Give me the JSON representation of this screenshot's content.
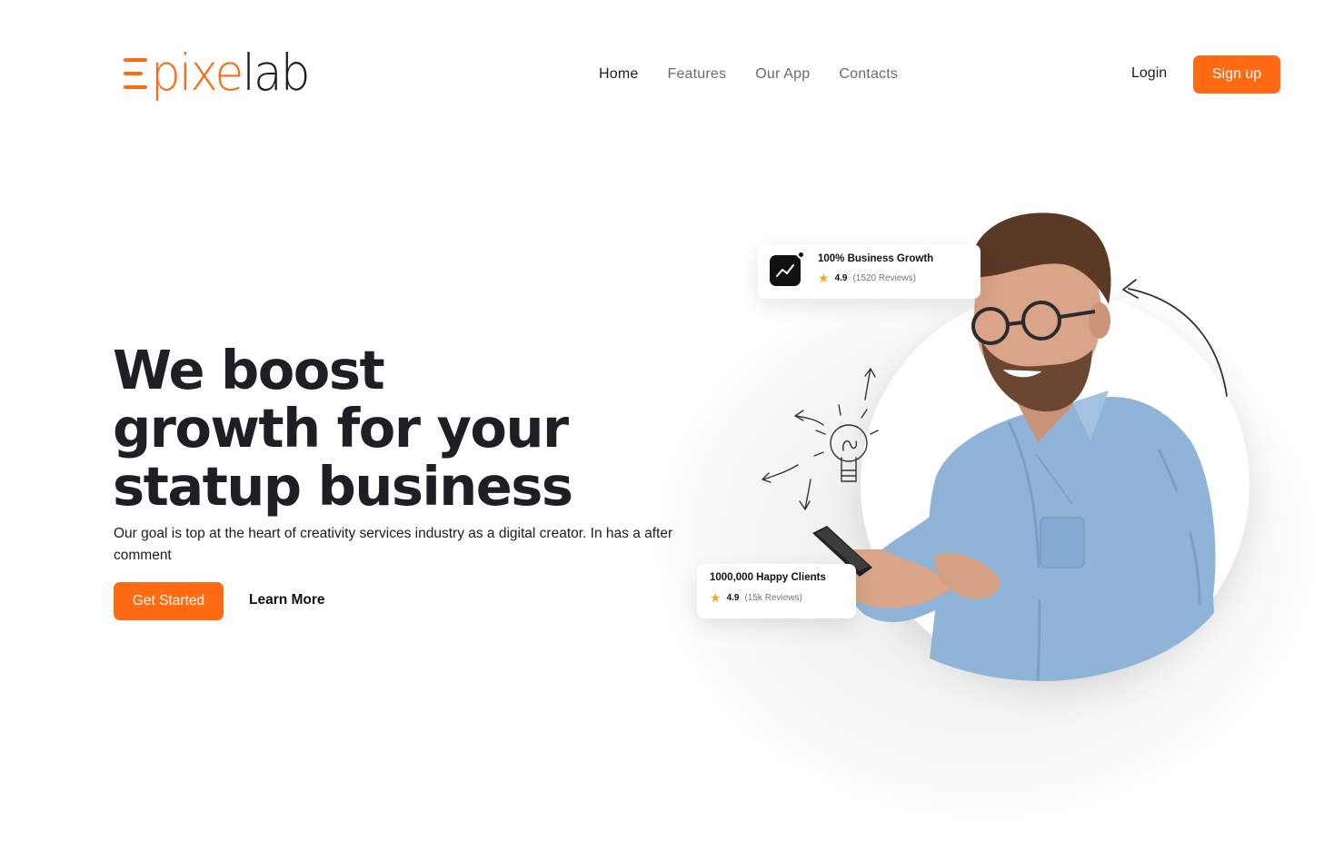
{
  "brand": {
    "logo_mark": "E",
    "logo_part1": "pixe",
    "logo_part2": "lab",
    "accent_color": "#ff6a13"
  },
  "nav": {
    "items": [
      {
        "label": "Home",
        "active": true
      },
      {
        "label": "Features",
        "active": false
      },
      {
        "label": "Our App",
        "active": false
      },
      {
        "label": "Contacts",
        "active": false
      }
    ]
  },
  "auth": {
    "login_label": "Login",
    "signup_label": "Sign up"
  },
  "hero": {
    "title_lines": [
      "We boost",
      "growth for your",
      "statup business"
    ],
    "subtitle": "Our goal is top at the heart of creativity services industry as a digital creator. In has a after comment",
    "primary_cta": "Get Started",
    "secondary_cta": "Learn More"
  },
  "cards": [
    {
      "title": "100% Business Growth",
      "rating": "4.9",
      "reviews": "(1520 Reviews)",
      "icon": "chart-trend-icon"
    },
    {
      "title": "1000,000 Happy Clients",
      "rating": "4.9",
      "reviews": "(15k Reviews)"
    }
  ]
}
